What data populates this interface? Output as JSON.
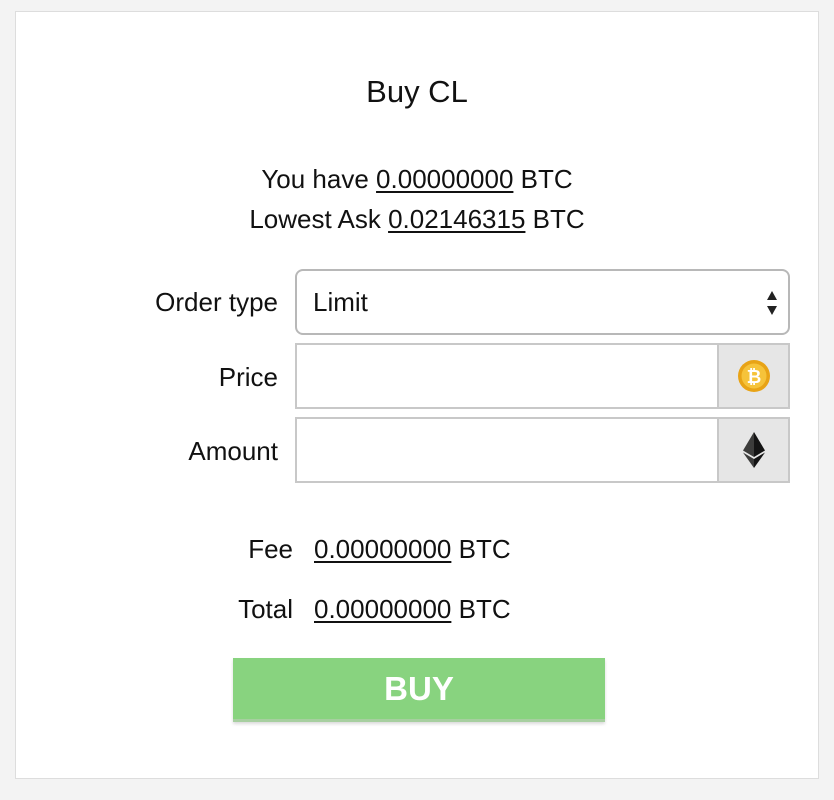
{
  "title": "Buy CL",
  "balance": {
    "prefix": "You have",
    "value": "0.00000000",
    "unit": "BTC"
  },
  "lowest_ask": {
    "prefix": "Lowest Ask",
    "value": "0.02146315",
    "unit": "BTC"
  },
  "form": {
    "order_type": {
      "label": "Order type",
      "selected": "Limit"
    },
    "price": {
      "label": "Price",
      "value": "",
      "addon_icon": "bitcoin-coin-icon"
    },
    "amount": {
      "label": "Amount",
      "value": "",
      "addon_icon": "ethereum-icon"
    }
  },
  "summary": {
    "fee": {
      "label": "Fee",
      "value": "0.00000000",
      "unit": "BTC"
    },
    "total": {
      "label": "Total",
      "value": "0.00000000",
      "unit": "BTC"
    }
  },
  "buy_button": {
    "label": "BUY"
  },
  "colors": {
    "buy_button": "#88d37f",
    "coin": "#f2a900",
    "addon_bg": "#e6e6e6"
  }
}
